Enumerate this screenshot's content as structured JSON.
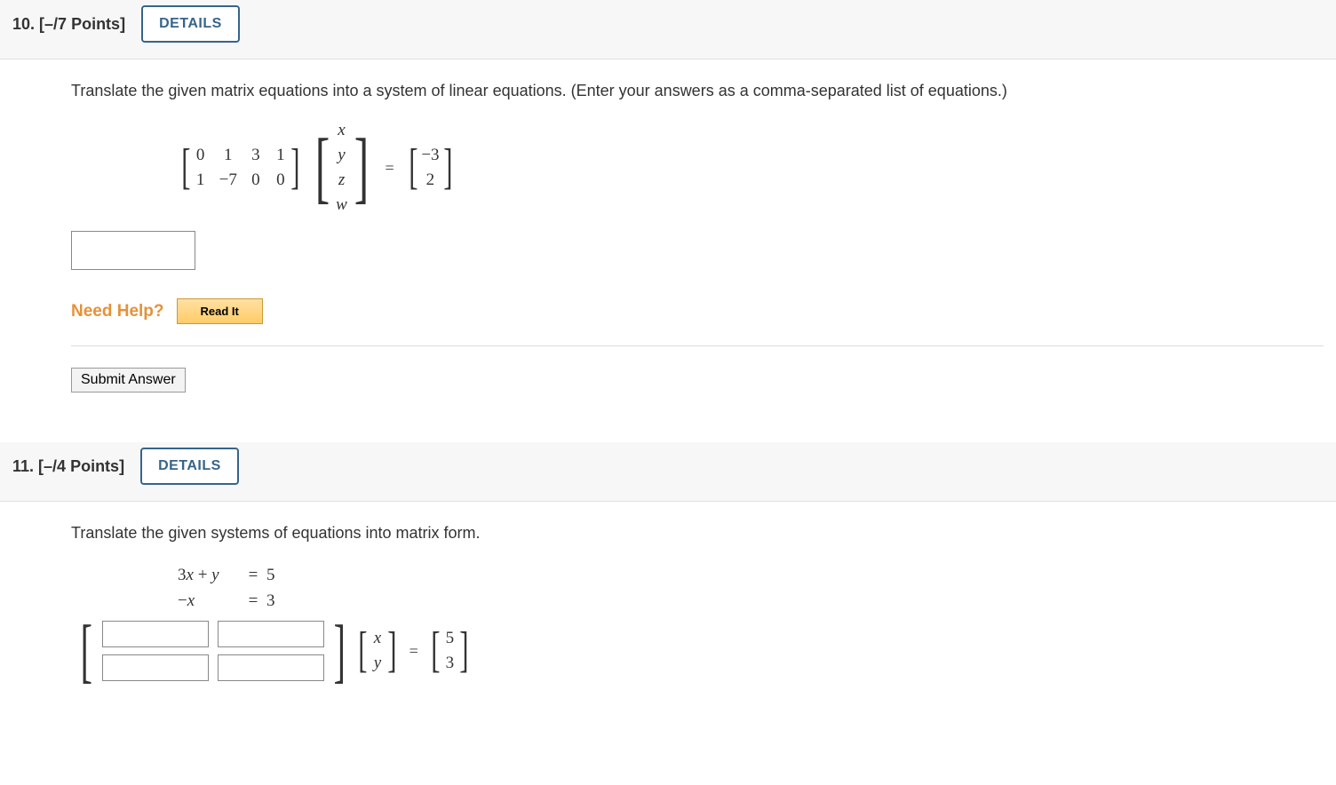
{
  "questions": [
    {
      "number": "10.",
      "points": "[–/7 Points]",
      "details_label": "DETAILS",
      "prompt": "Translate the given matrix equations into a system of linear equations. (Enter your answers as a comma-separated list of equations.)",
      "matrix_A": [
        [
          "0",
          "1",
          "3",
          "1"
        ],
        [
          "1",
          "−7",
          "0",
          "0"
        ]
      ],
      "vector_vars": [
        "x",
        "y",
        "z",
        "w"
      ],
      "vector_b": [
        "−3",
        "2"
      ],
      "need_help_label": "Need Help?",
      "read_it_label": "Read It",
      "submit_label": "Submit Answer"
    },
    {
      "number": "11.",
      "points": "[–/4 Points]",
      "details_label": "DETAILS",
      "prompt": "Translate the given systems of equations into matrix form.",
      "system": [
        {
          "lhs": "3x + y",
          "eq": "=",
          "rhs": "5"
        },
        {
          "lhs": "−x",
          "eq": "=",
          "rhs": "3"
        }
      ],
      "vector_vars2": [
        "x",
        "y"
      ],
      "vector_b2": [
        "5",
        "3"
      ]
    }
  ]
}
